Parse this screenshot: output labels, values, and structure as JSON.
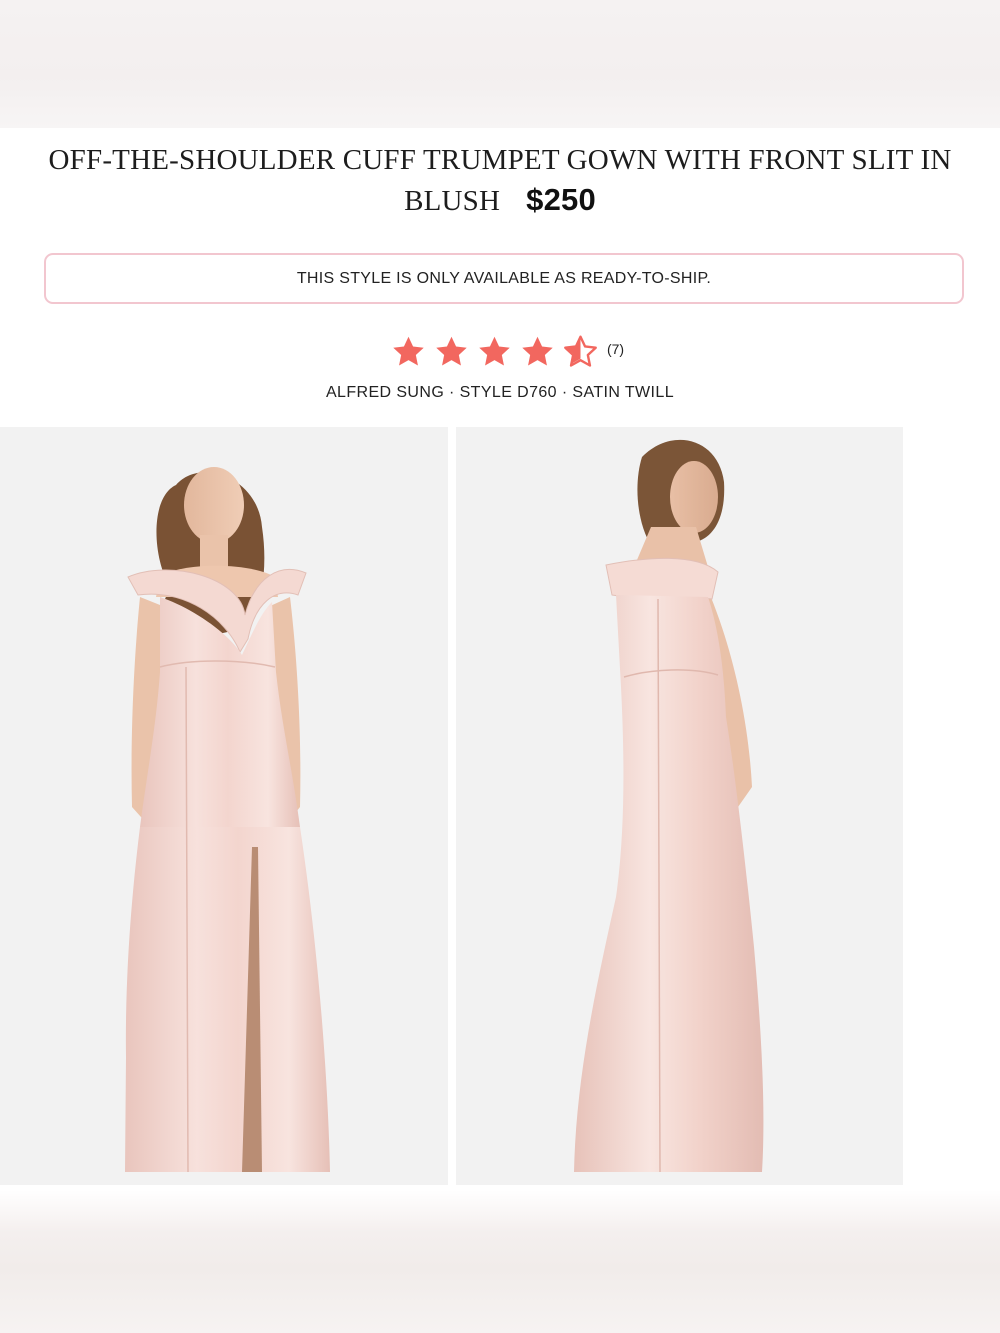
{
  "product": {
    "title_line1": "OFF-THE-SHOULDER CUFF TRUMPET GOWN WITH FRONT SLIT IN",
    "title_line2": "BLUSH",
    "price": "$250"
  },
  "notice": "THIS STYLE IS ONLY AVAILABLE AS READY-TO-SHIP.",
  "rating": {
    "value": 4.5,
    "max": 5,
    "count": "(7)",
    "star_color": "#f2675f"
  },
  "meta": "ALFRED SUNG · STYLE D760 · SATIN TWILL",
  "images": [
    {
      "name": "front-view-photo",
      "alt": ""
    },
    {
      "name": "back-view-photo",
      "alt": ""
    }
  ],
  "colors": {
    "gown": "#f2d2cb",
    "notice_border": "#f2c6cf"
  }
}
